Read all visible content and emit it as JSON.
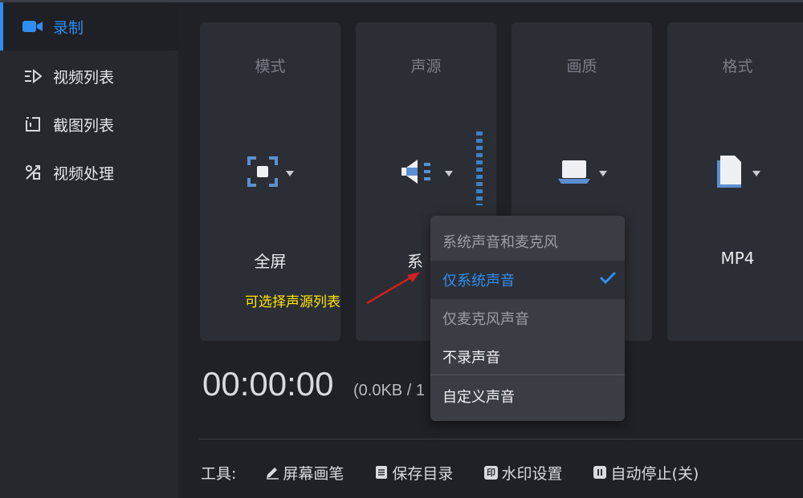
{
  "sidebar": {
    "items": [
      {
        "label": "录制",
        "icon": "video-camera-icon",
        "active": true
      },
      {
        "label": "视频列表",
        "icon": "video-list-icon",
        "active": false
      },
      {
        "label": "截图列表",
        "icon": "screenshot-list-icon",
        "active": false
      },
      {
        "label": "视频处理",
        "icon": "video-edit-icon",
        "active": false
      }
    ]
  },
  "cards": {
    "mode": {
      "title": "模式",
      "value": "全屏",
      "icon": "fullscreen-icon"
    },
    "audio": {
      "title": "声源",
      "value": "系统声音",
      "icon": "speaker-icon"
    },
    "quality": {
      "title": "画质",
      "value": "",
      "icon": "laptop-icon"
    },
    "format": {
      "title": "格式",
      "value": "MP4",
      "icon": "file-icon"
    }
  },
  "audio_value_visible": "系",
  "timer": "00:00:00",
  "size": "(0.0KB / 1",
  "toolbar": {
    "label": "工具:",
    "items": [
      {
        "label": "屏幕画笔",
        "icon": "pen-icon"
      },
      {
        "label": "保存目录",
        "icon": "folder-doc-icon"
      },
      {
        "label": "水印设置",
        "icon": "watermark-icon"
      },
      {
        "label": "自动停止(关)",
        "icon": "auto-stop-icon"
      }
    ]
  },
  "dropdown": {
    "options": [
      "系统声音和麦克风",
      "仅系统声音",
      "仅麦克风声音",
      "不录声音",
      "自定义声音"
    ],
    "selected": "仅系统声音"
  },
  "annotation": "可选择声源列表",
  "colors": {
    "accent": "#2f8ef0",
    "annotation": "#ffe600",
    "annotation_arrow": "#d21f1f"
  }
}
